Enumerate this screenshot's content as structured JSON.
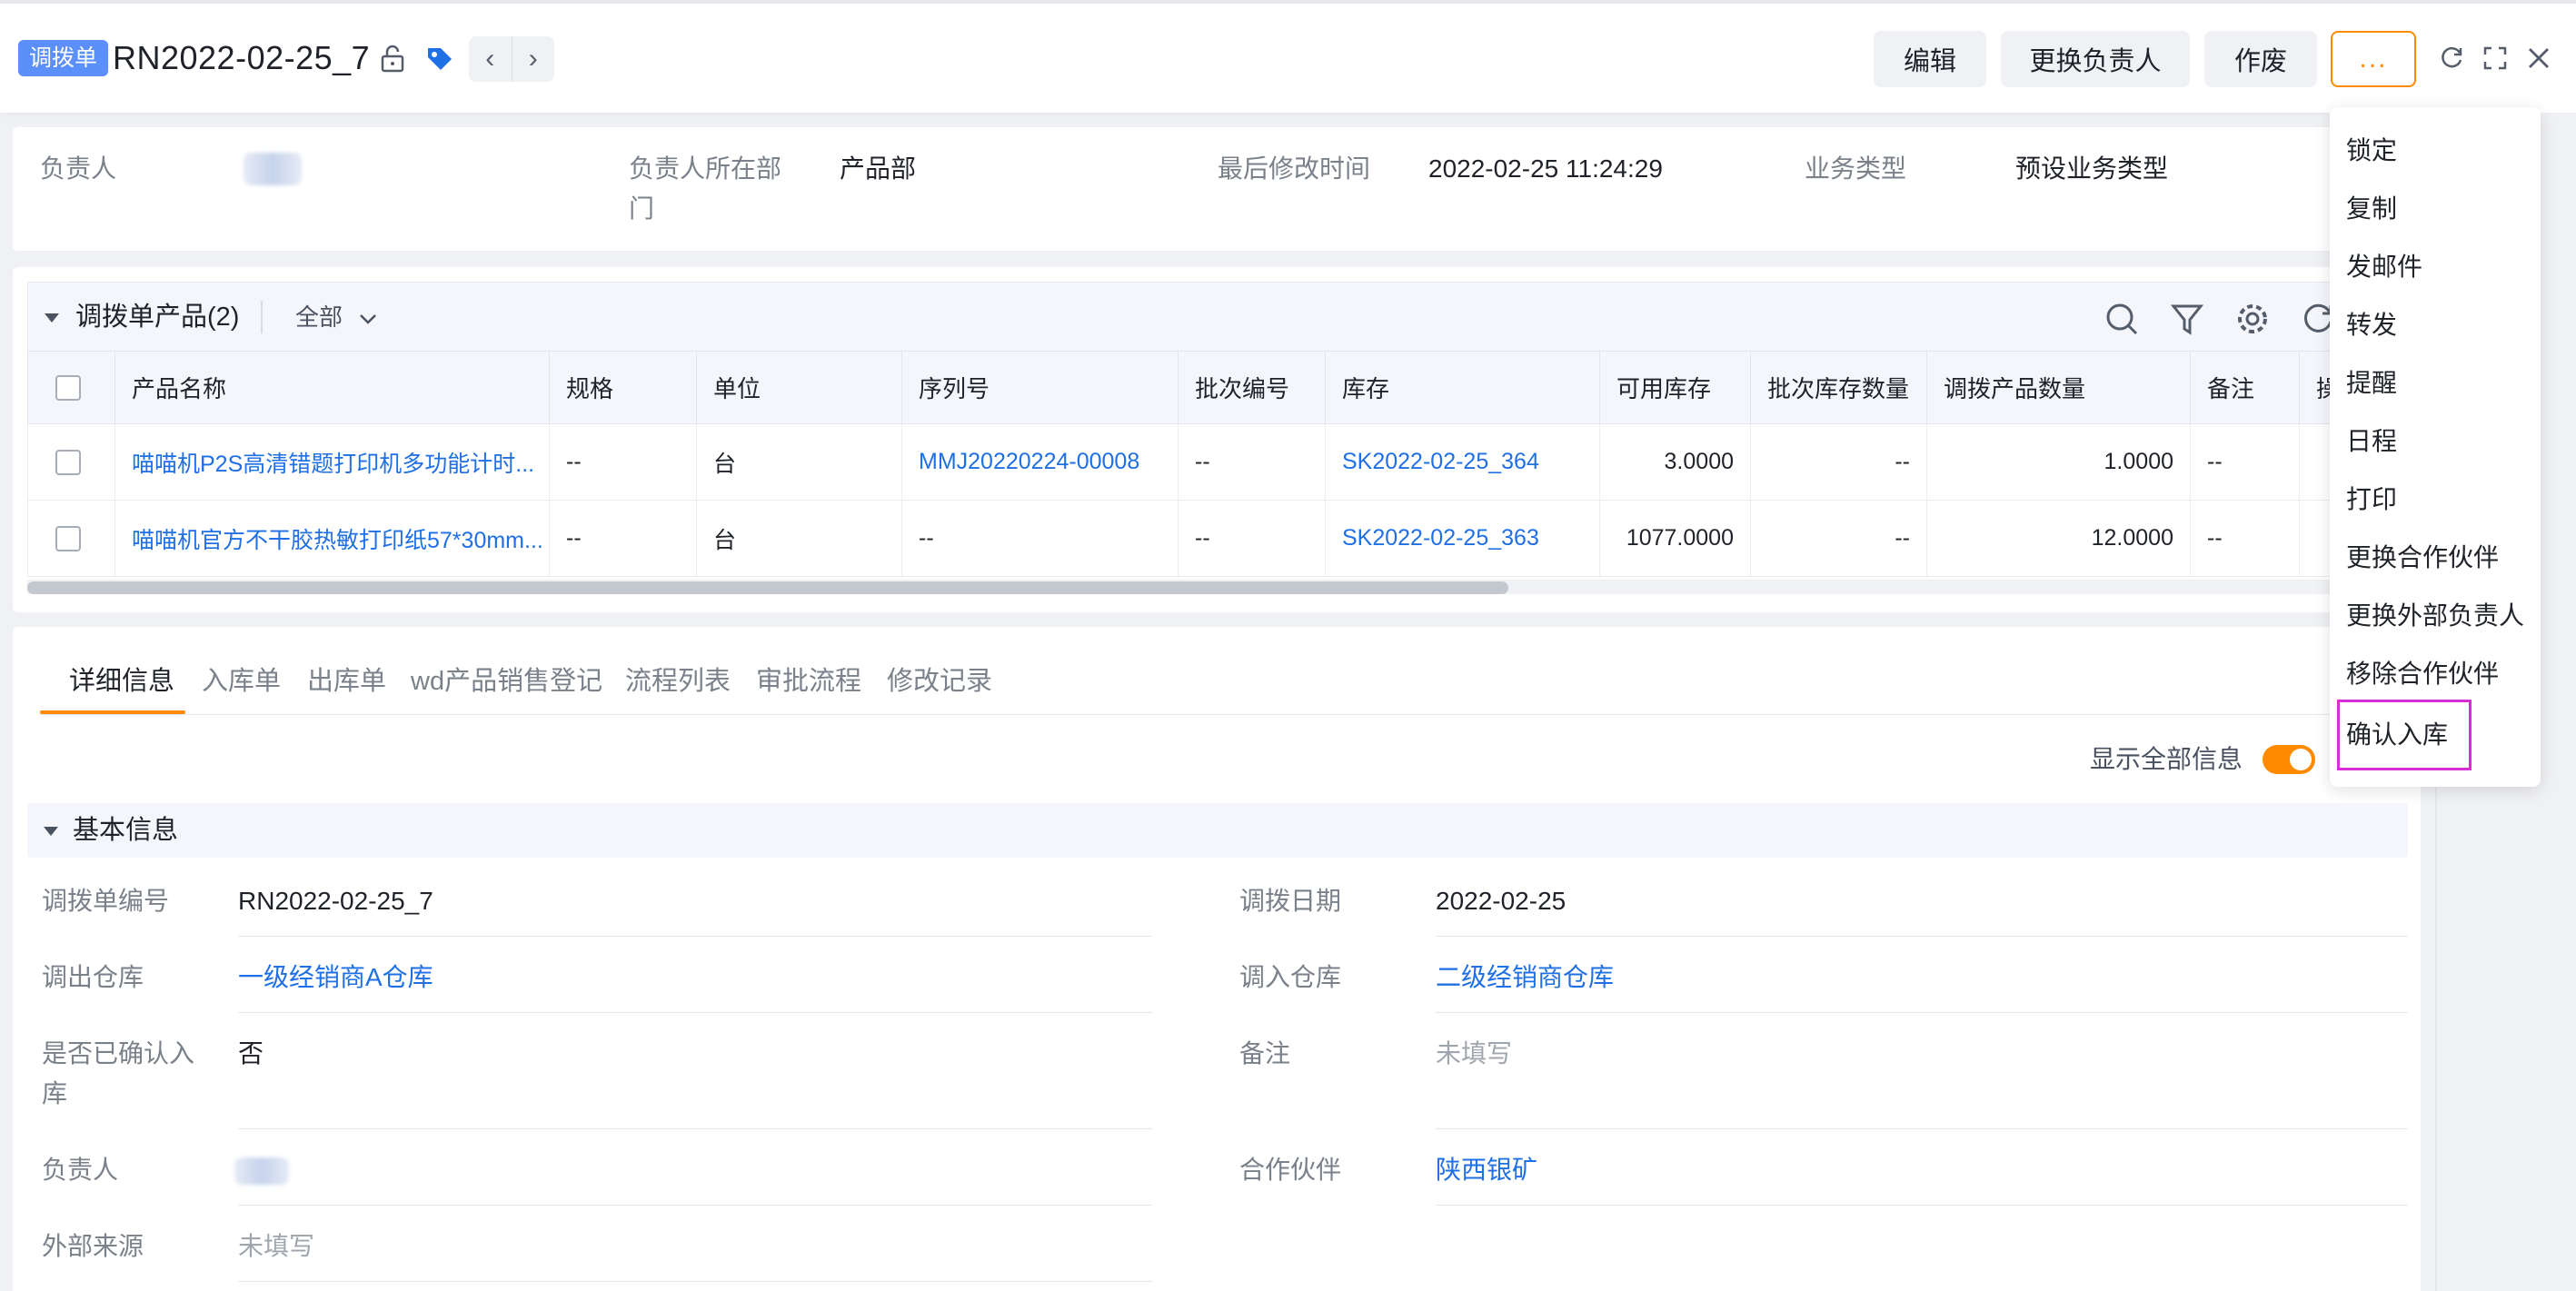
{
  "header": {
    "badge": "调拨单",
    "title": "RN2022-02-25_7",
    "prev_label": "‹",
    "next_label": "›",
    "buttons": {
      "edit": "编辑",
      "change_owner": "更换负责人",
      "void": "作废",
      "more": "..."
    }
  },
  "summary": {
    "owner_label": "负责人",
    "dept_label": "负责人所在部门",
    "dept_value": "产品部",
    "modified_label": "最后修改时间",
    "modified_value": "2022-02-25 11:24:29",
    "biz_type_label": "业务类型",
    "biz_type_value": "预设业务类型"
  },
  "products": {
    "title": "调拨单产品(2)",
    "filter": "全部",
    "columns": [
      "产品名称",
      "规格",
      "单位",
      "序列号",
      "批次编号",
      "库存",
      "可用库存",
      "批次库存数量",
      "调拨产品数量",
      "备注",
      "操作"
    ],
    "rows": [
      {
        "name": "喵喵机P2S高清错题打印机多功能计时...",
        "spec": "--",
        "unit": "台",
        "serial": "MMJ20220224-00008",
        "batch": "--",
        "stock": "SK2022-02-25_364",
        "available": "3.0000",
        "batch_qty": "--",
        "qty": "1.0000",
        "remark": "--"
      },
      {
        "name": "喵喵机官方不干胶热敏打印纸57*30mm...",
        "spec": "--",
        "unit": "台",
        "serial": "--",
        "batch": "--",
        "stock": "SK2022-02-25_363",
        "available": "1077.0000",
        "batch_qty": "--",
        "qty": "12.0000",
        "remark": "--"
      }
    ]
  },
  "tabs": [
    "详细信息",
    "入库单",
    "出库单",
    "wd产品销售登记",
    "流程列表",
    "审批流程",
    "修改记录"
  ],
  "detail": {
    "show_all_label": "显示全部信息",
    "show_all_on": true,
    "section_title": "基本信息",
    "fields": {
      "transfer_no_label": "调拨单编号",
      "transfer_no_value": "RN2022-02-25_7",
      "transfer_date_label": "调拨日期",
      "transfer_date_value": "2022-02-25",
      "out_wh_label": "调出仓库",
      "out_wh_value": "一级经销商A仓库",
      "in_wh_label": "调入仓库",
      "in_wh_value": "二级经销商仓库",
      "confirmed_label": "是否已确认入库",
      "confirmed_value": "否",
      "remark_label": "备注",
      "remark_value": "未填写",
      "owner_label": "负责人",
      "partner_label": "合作伙伴",
      "partner_value": "陕西银矿",
      "ext_source_label": "外部来源",
      "ext_source_value": "未填写"
    }
  },
  "menu": [
    "锁定",
    "复制",
    "发邮件",
    "转发",
    "提醒",
    "日程",
    "打印",
    "更换合作伙伴",
    "更换外部负责人",
    "移除合作伙伴",
    "确认入库"
  ],
  "colors": {
    "accent": "#ff8a00",
    "link": "#1f6fe5",
    "badge": "#5b8ff9",
    "highlight": "#d62fd6"
  }
}
